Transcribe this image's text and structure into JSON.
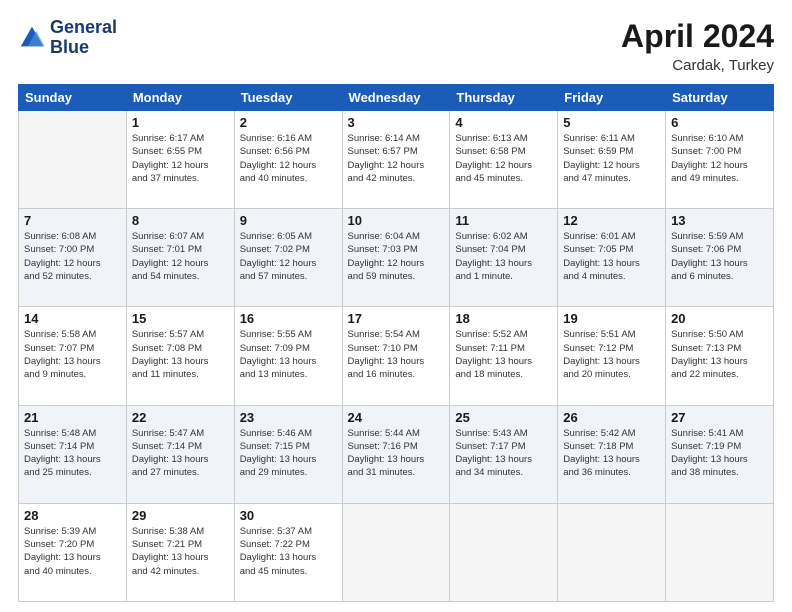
{
  "header": {
    "logo_line1": "General",
    "logo_line2": "Blue",
    "month_year": "April 2024",
    "location": "Cardak, Turkey"
  },
  "weekdays": [
    "Sunday",
    "Monday",
    "Tuesday",
    "Wednesday",
    "Thursday",
    "Friday",
    "Saturday"
  ],
  "weeks": [
    [
      {
        "day": "",
        "info": ""
      },
      {
        "day": "1",
        "info": "Sunrise: 6:17 AM\nSunset: 6:55 PM\nDaylight: 12 hours\nand 37 minutes."
      },
      {
        "day": "2",
        "info": "Sunrise: 6:16 AM\nSunset: 6:56 PM\nDaylight: 12 hours\nand 40 minutes."
      },
      {
        "day": "3",
        "info": "Sunrise: 6:14 AM\nSunset: 6:57 PM\nDaylight: 12 hours\nand 42 minutes."
      },
      {
        "day": "4",
        "info": "Sunrise: 6:13 AM\nSunset: 6:58 PM\nDaylight: 12 hours\nand 45 minutes."
      },
      {
        "day": "5",
        "info": "Sunrise: 6:11 AM\nSunset: 6:59 PM\nDaylight: 12 hours\nand 47 minutes."
      },
      {
        "day": "6",
        "info": "Sunrise: 6:10 AM\nSunset: 7:00 PM\nDaylight: 12 hours\nand 49 minutes."
      }
    ],
    [
      {
        "day": "7",
        "info": "Sunrise: 6:08 AM\nSunset: 7:00 PM\nDaylight: 12 hours\nand 52 minutes."
      },
      {
        "day": "8",
        "info": "Sunrise: 6:07 AM\nSunset: 7:01 PM\nDaylight: 12 hours\nand 54 minutes."
      },
      {
        "day": "9",
        "info": "Sunrise: 6:05 AM\nSunset: 7:02 PM\nDaylight: 12 hours\nand 57 minutes."
      },
      {
        "day": "10",
        "info": "Sunrise: 6:04 AM\nSunset: 7:03 PM\nDaylight: 12 hours\nand 59 minutes."
      },
      {
        "day": "11",
        "info": "Sunrise: 6:02 AM\nSunset: 7:04 PM\nDaylight: 13 hours\nand 1 minute."
      },
      {
        "day": "12",
        "info": "Sunrise: 6:01 AM\nSunset: 7:05 PM\nDaylight: 13 hours\nand 4 minutes."
      },
      {
        "day": "13",
        "info": "Sunrise: 5:59 AM\nSunset: 7:06 PM\nDaylight: 13 hours\nand 6 minutes."
      }
    ],
    [
      {
        "day": "14",
        "info": "Sunrise: 5:58 AM\nSunset: 7:07 PM\nDaylight: 13 hours\nand 9 minutes."
      },
      {
        "day": "15",
        "info": "Sunrise: 5:57 AM\nSunset: 7:08 PM\nDaylight: 13 hours\nand 11 minutes."
      },
      {
        "day": "16",
        "info": "Sunrise: 5:55 AM\nSunset: 7:09 PM\nDaylight: 13 hours\nand 13 minutes."
      },
      {
        "day": "17",
        "info": "Sunrise: 5:54 AM\nSunset: 7:10 PM\nDaylight: 13 hours\nand 16 minutes."
      },
      {
        "day": "18",
        "info": "Sunrise: 5:52 AM\nSunset: 7:11 PM\nDaylight: 13 hours\nand 18 minutes."
      },
      {
        "day": "19",
        "info": "Sunrise: 5:51 AM\nSunset: 7:12 PM\nDaylight: 13 hours\nand 20 minutes."
      },
      {
        "day": "20",
        "info": "Sunrise: 5:50 AM\nSunset: 7:13 PM\nDaylight: 13 hours\nand 22 minutes."
      }
    ],
    [
      {
        "day": "21",
        "info": "Sunrise: 5:48 AM\nSunset: 7:14 PM\nDaylight: 13 hours\nand 25 minutes."
      },
      {
        "day": "22",
        "info": "Sunrise: 5:47 AM\nSunset: 7:14 PM\nDaylight: 13 hours\nand 27 minutes."
      },
      {
        "day": "23",
        "info": "Sunrise: 5:46 AM\nSunset: 7:15 PM\nDaylight: 13 hours\nand 29 minutes."
      },
      {
        "day": "24",
        "info": "Sunrise: 5:44 AM\nSunset: 7:16 PM\nDaylight: 13 hours\nand 31 minutes."
      },
      {
        "day": "25",
        "info": "Sunrise: 5:43 AM\nSunset: 7:17 PM\nDaylight: 13 hours\nand 34 minutes."
      },
      {
        "day": "26",
        "info": "Sunrise: 5:42 AM\nSunset: 7:18 PM\nDaylight: 13 hours\nand 36 minutes."
      },
      {
        "day": "27",
        "info": "Sunrise: 5:41 AM\nSunset: 7:19 PM\nDaylight: 13 hours\nand 38 minutes."
      }
    ],
    [
      {
        "day": "28",
        "info": "Sunrise: 5:39 AM\nSunset: 7:20 PM\nDaylight: 13 hours\nand 40 minutes."
      },
      {
        "day": "29",
        "info": "Sunrise: 5:38 AM\nSunset: 7:21 PM\nDaylight: 13 hours\nand 42 minutes."
      },
      {
        "day": "30",
        "info": "Sunrise: 5:37 AM\nSunset: 7:22 PM\nDaylight: 13 hours\nand 45 minutes."
      },
      {
        "day": "",
        "info": ""
      },
      {
        "day": "",
        "info": ""
      },
      {
        "day": "",
        "info": ""
      },
      {
        "day": "",
        "info": ""
      }
    ]
  ]
}
